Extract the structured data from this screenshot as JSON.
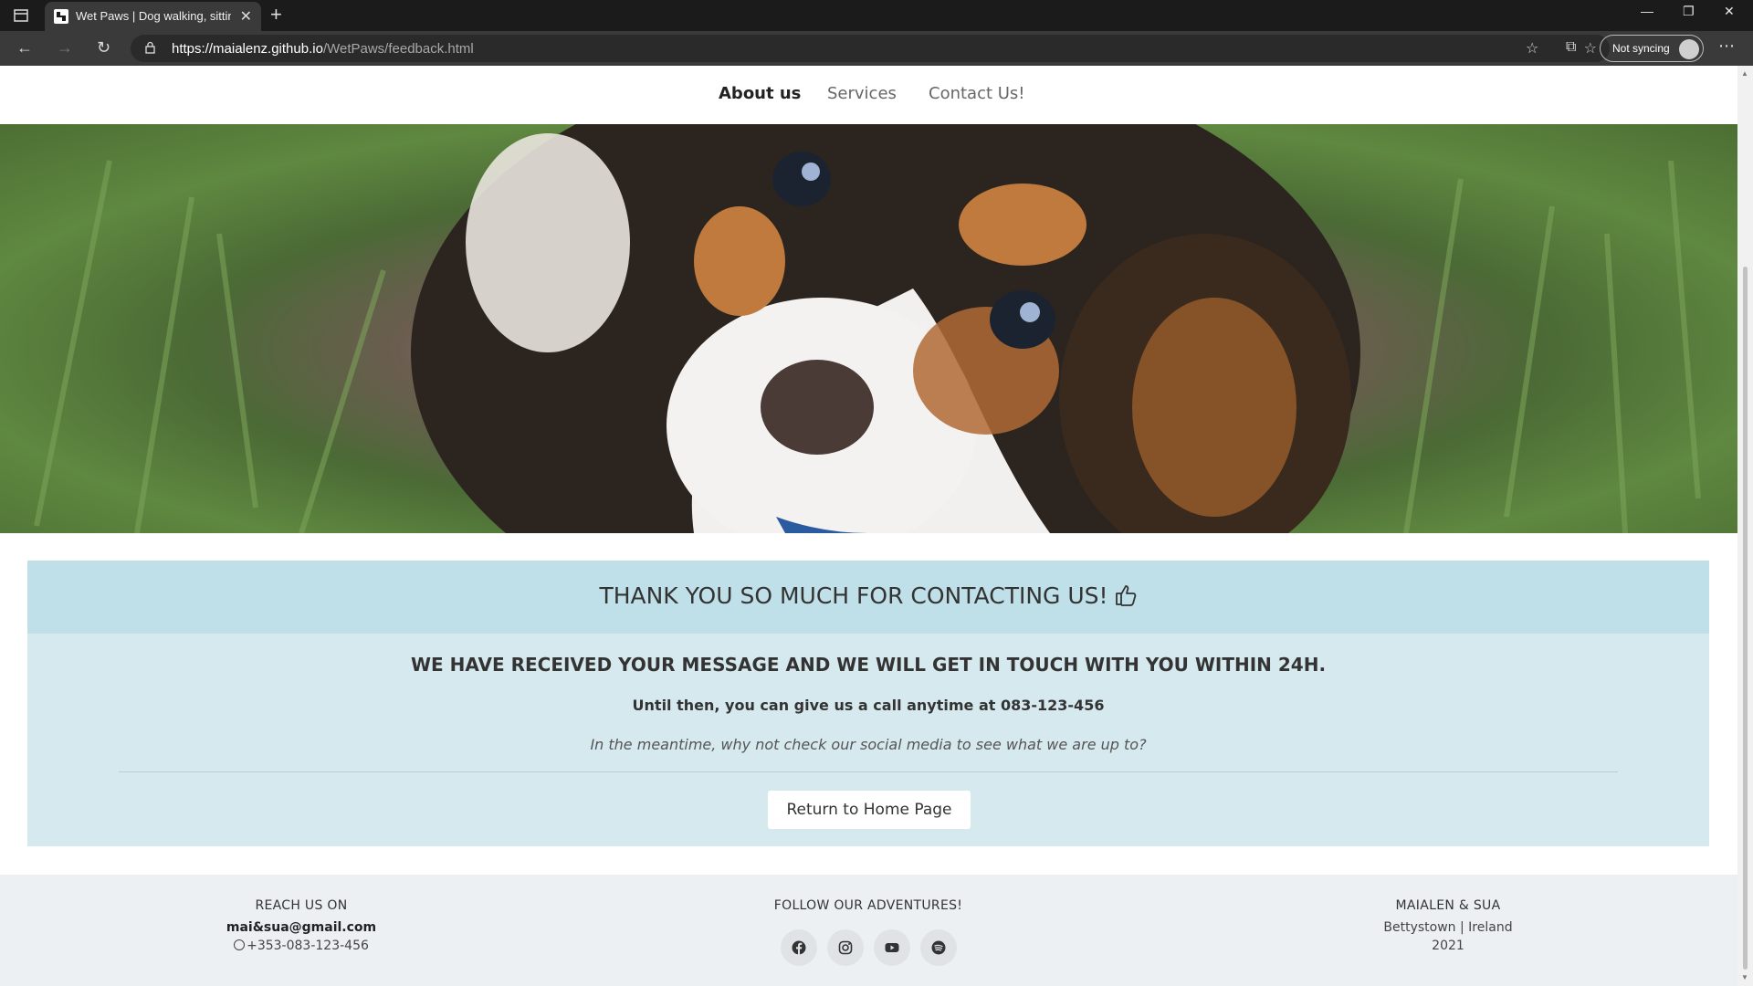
{
  "browser": {
    "tab_title": "Wet Paws | Dog walking, sitting and",
    "url_host": "https://maialenz.github.io",
    "url_path": "/WetPaws/feedback.html",
    "sync_label": "Not syncing"
  },
  "nav": {
    "items": [
      {
        "label": "About us"
      },
      {
        "label": "Services"
      },
      {
        "label": "Contact Us!"
      }
    ]
  },
  "hero": {
    "description": "puppy-photo"
  },
  "feedback": {
    "heading": "THANK YOU SO MUCH FOR CONTACTING US!",
    "message": "WE HAVE RECEIVED YOUR MESSAGE AND WE WILL GET IN TOUCH WITH YOU WITHIN 24H.",
    "call_text": "Until then, you can give us a call anytime at 083-123-456",
    "social_text": "In the meantime, why not check our social media to see what we are up to?",
    "button_label": "Return to Home Page"
  },
  "footer": {
    "reach": {
      "heading": "REACH US ON",
      "email": "mai&sua@gmail.com",
      "phone": "+353-083-123-456"
    },
    "follow": {
      "heading": "FOLLOW OUR ADVENTURES!",
      "icons": [
        "facebook-icon",
        "instagram-icon",
        "youtube-icon",
        "spotify-icon"
      ]
    },
    "company": {
      "heading": "MAIALEN & SUA",
      "location": "Bettystown | Ireland",
      "year": "2021"
    }
  },
  "colors": {
    "card_header": "#bfe0e8",
    "card_body": "#d5e9ef",
    "footer_bg": "#ecf0f3"
  }
}
